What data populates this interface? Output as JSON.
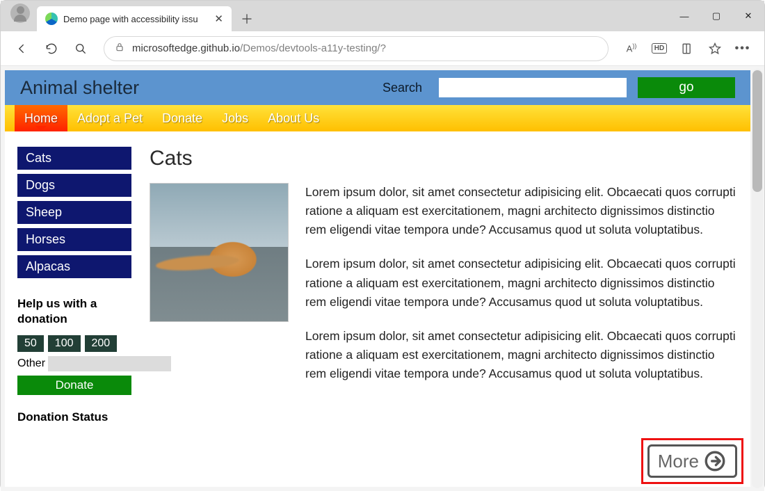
{
  "browser": {
    "tab_title": "Demo page with accessibility issu",
    "url_host": "microsoftedge.github.io",
    "url_path": "/Demos/devtools-a11y-testing/?"
  },
  "header": {
    "site_title": "Animal shelter",
    "search_label": "Search",
    "go_label": "go"
  },
  "nav": {
    "items": [
      {
        "label": "Home",
        "active": true
      },
      {
        "label": "Adopt a Pet",
        "active": false
      },
      {
        "label": "Donate",
        "active": false
      },
      {
        "label": "Jobs",
        "active": false
      },
      {
        "label": "About Us",
        "active": false
      }
    ]
  },
  "sidebar": {
    "links": [
      "Cats",
      "Dogs",
      "Sheep",
      "Horses",
      "Alpacas"
    ],
    "donation_title": "Help us with a donation",
    "amounts": [
      "50",
      "100",
      "200"
    ],
    "other_label": "Other",
    "donate_label": "Donate",
    "status_title": "Donation Status"
  },
  "main": {
    "heading": "Cats",
    "paragraphs": [
      "Lorem ipsum dolor, sit amet consectetur adipisicing elit. Obcaecati quos corrupti ratione a aliquam est exercitationem, magni architecto dignissimos distinctio rem eligendi vitae tempora unde? Accusamus quod ut soluta voluptatibus.",
      "Lorem ipsum dolor, sit amet consectetur adipisicing elit. Obcaecati quos corrupti ratione a aliquam est exercitationem, magni architecto dignissimos distinctio rem eligendi vitae tempora unde? Accusamus quod ut soluta voluptatibus.",
      "Lorem ipsum dolor, sit amet consectetur adipisicing elit. Obcaecati quos corrupti ratione a aliquam est exercitationem, magni architecto dignissimos distinctio rem eligendi vitae tempora unde? Accusamus quod ut soluta voluptatibus."
    ],
    "more_label": "More"
  }
}
